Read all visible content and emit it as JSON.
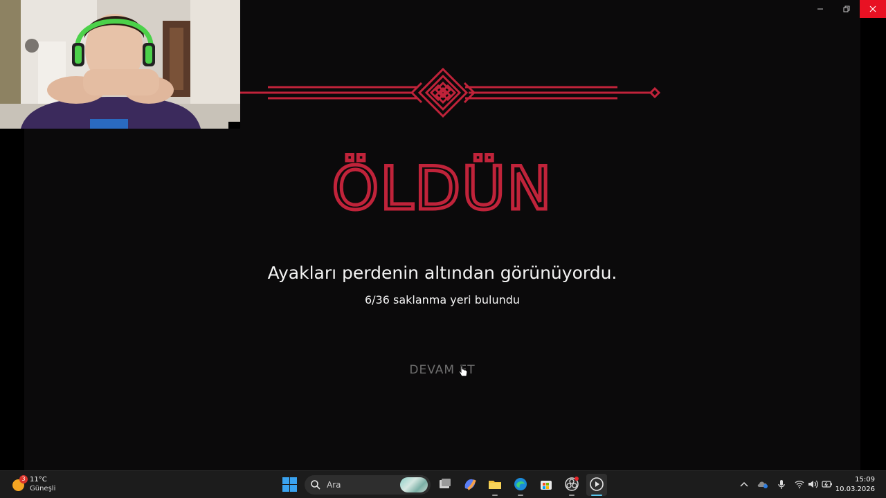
{
  "game": {
    "title": "ÖLDÜN",
    "message": "Ayakları perdenin altından görünüyordu.",
    "progress": "6/36 saklanma yeri bulundu",
    "continue_label": "DEVAM ET",
    "accent_color": "#c0233a"
  },
  "window": {
    "minimize_icon": "minimize-icon",
    "restore_icon": "restore-icon",
    "close_icon": "close-icon"
  },
  "taskbar": {
    "weather": {
      "badge": "3",
      "temperature": "11°C",
      "condition": "Güneşli"
    },
    "search_placeholder": "Ara",
    "apps": [
      "task-view-icon",
      "copilot-icon",
      "file-explorer-icon",
      "edge-icon",
      "store-icon",
      "obs-icon",
      "media-player-icon"
    ],
    "tray_icons": [
      "chevron-up-icon",
      "onedrive-icon",
      "microphone-icon",
      "wifi-icon",
      "volume-icon",
      "battery-icon"
    ],
    "time": "15:09",
    "date": "10.03.2026"
  }
}
